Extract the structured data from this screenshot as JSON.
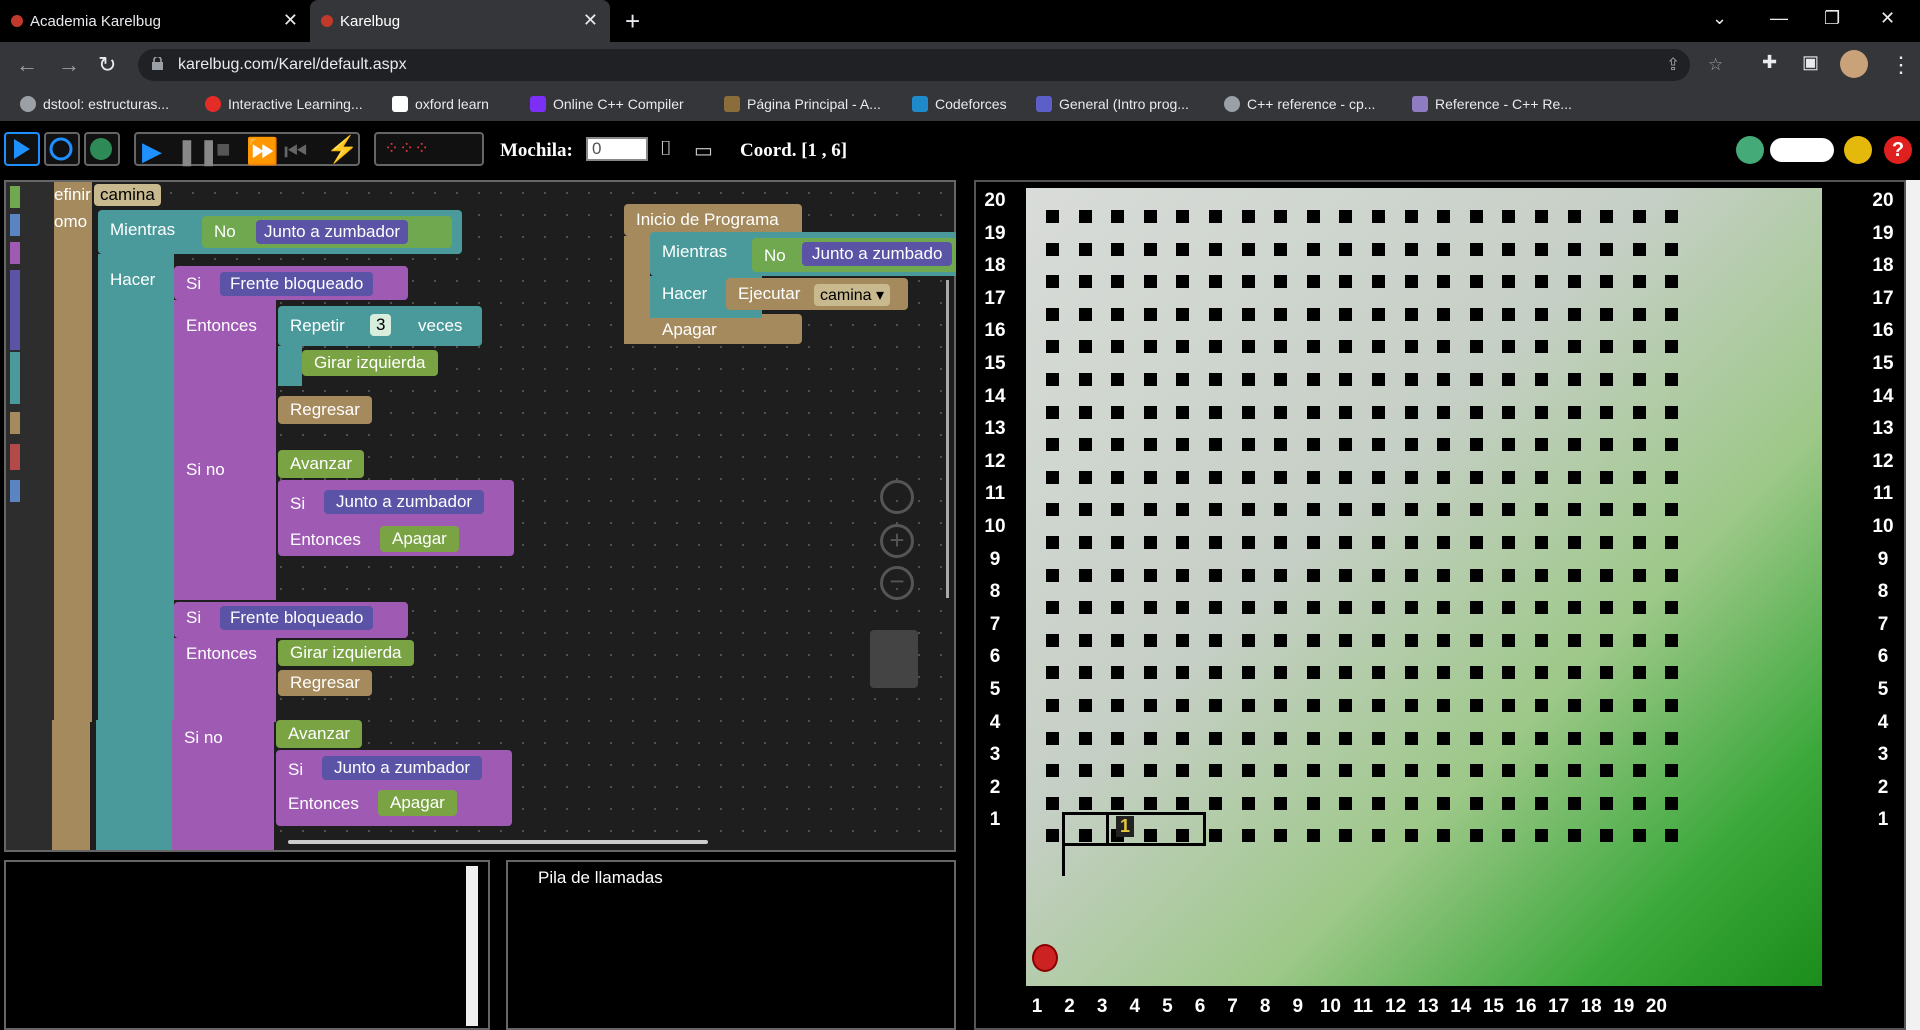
{
  "browser": {
    "tabs": [
      {
        "title": "Academia Karelbug"
      },
      {
        "title": "Karelbug"
      }
    ],
    "url": "karelbug.com/Karel/default.aspx",
    "bookmarks": [
      {
        "label": "dstool: estructuras...",
        "color": "#9aa0a6"
      },
      {
        "label": "Interactive Learning...",
        "color": "#e52d27"
      },
      {
        "label": "oxford learn",
        "color": "#002147"
      },
      {
        "label": "Online C++ Compiler",
        "color": "#7b2ff7"
      },
      {
        "label": "Página Principal - A...",
        "color": "#8a6d3b"
      },
      {
        "label": "Codeforces",
        "color": "#1f8acb"
      },
      {
        "label": "General (Intro prog...",
        "color": "#5b5fc7"
      },
      {
        "label": "C++ reference - cp...",
        "color": "#9aa0a6"
      },
      {
        "label": "Reference - C++ Re...",
        "color": "#8e7cc3"
      }
    ]
  },
  "toolbar": {
    "mochila_label": "Mochila:",
    "mochila_value": "0",
    "coord_label": "Coord. [1 , 6]"
  },
  "blocks": {
    "definir": "efinir",
    "definir_name": "camina",
    "como": "omo",
    "mientras": "Mientras",
    "no": "No",
    "junto_zumbador": "Junto a zumbador",
    "hacer": "Hacer",
    "si": "Si",
    "frente_bloqueado": "Frente bloqueado",
    "entonces": "Entonces",
    "repetir": "Repetir",
    "repetir_n": "3",
    "veces": "veces",
    "girar_izquierda": "Girar izquierda",
    "regresar": "Regresar",
    "si_no": "Si no",
    "avanzar": "Avanzar",
    "apagar": "Apagar",
    "inicio": "Inicio de Programa",
    "junto_zumbador_cut": "Junto a zumbado",
    "ejecutar": "Ejecutar",
    "ejecutar_name": "camina ▾"
  },
  "panels": {
    "call_stack": "Pila de llamadas"
  },
  "world": {
    "rows": [
      "20",
      "19",
      "18",
      "17",
      "16",
      "15",
      "14",
      "13",
      "12",
      "11",
      "10",
      "9",
      "8",
      "7",
      "6",
      "5",
      "4",
      "3",
      "2",
      "1"
    ],
    "cols": [
      "1",
      "2",
      "3",
      "4",
      "5",
      "6",
      "7",
      "8",
      "9",
      "10",
      "11",
      "12",
      "13",
      "14",
      "15",
      "16",
      "17",
      "18",
      "19",
      "20"
    ],
    "beeper_count": "1",
    "karel_street": 1,
    "karel_avenue": 1
  },
  "colors": {
    "accent": "#1e90ff",
    "grid_green": "#1b8d1b"
  }
}
